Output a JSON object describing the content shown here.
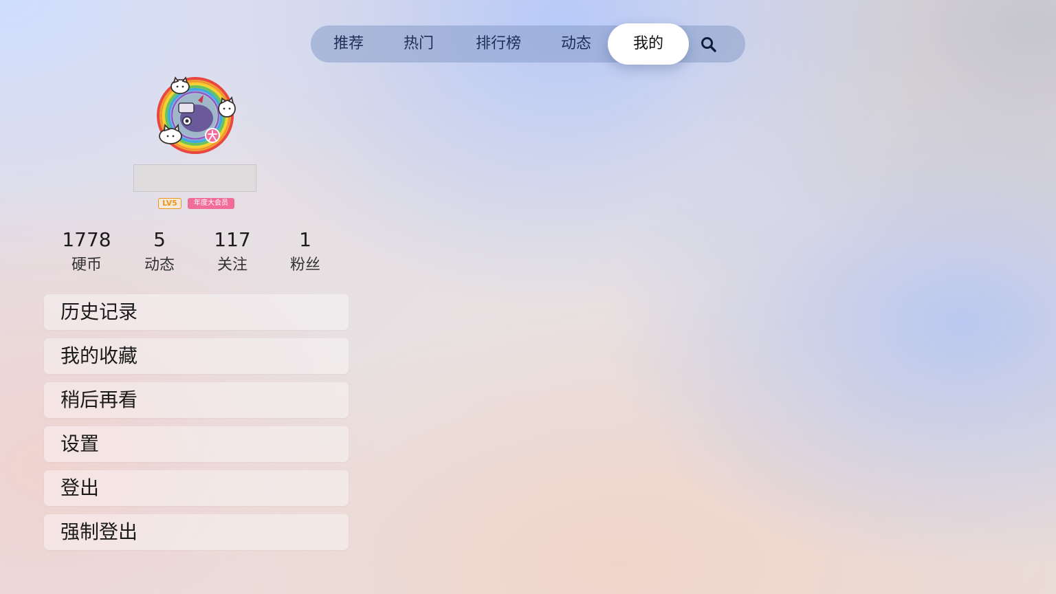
{
  "nav": {
    "tabs": [
      {
        "label": "推荐",
        "active": false
      },
      {
        "label": "热门",
        "active": false
      },
      {
        "label": "排行榜",
        "active": false
      },
      {
        "label": "动态",
        "active": false
      },
      {
        "label": "我的",
        "active": true
      }
    ],
    "search_icon": "search-icon"
  },
  "profile": {
    "avatar_icon": "avatar-rainbow-frame",
    "level_badge": "LV5",
    "vip_badge": "年度大会员"
  },
  "stats": [
    {
      "value": "1778",
      "label": "硬币"
    },
    {
      "value": "5",
      "label": "动态"
    },
    {
      "value": "117",
      "label": "关注"
    },
    {
      "value": "1",
      "label": "粉丝"
    }
  ],
  "menu": [
    {
      "label": "历史记录"
    },
    {
      "label": "我的收藏"
    },
    {
      "label": "稍后再看"
    },
    {
      "label": "设置"
    },
    {
      "label": "登出"
    },
    {
      "label": "强制登出"
    }
  ],
  "colors": {
    "nav_bar": "#869dc8",
    "active_tab": "#ffffff",
    "level_badge": "#f0941b",
    "vip_badge": "#f06d98"
  }
}
